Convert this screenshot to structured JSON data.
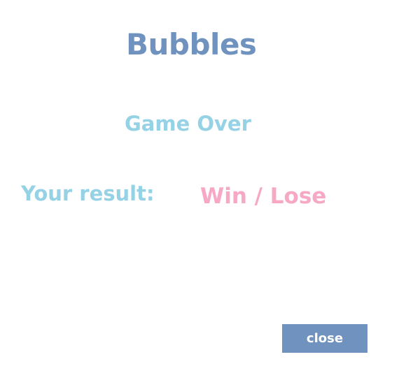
{
  "game": {
    "title": "Bubbles",
    "status": "Game Over",
    "result_label": "Your result:",
    "result_value": "Win / Lose",
    "close_label": "close"
  },
  "colors": {
    "title": "#6f92bf",
    "status": "#95d2e6",
    "result_label": "#95d2e6",
    "result_value": "#f7a8c4",
    "button_bg": "#6f92bf",
    "button_text": "#ffffff",
    "background": "#ffffff"
  }
}
